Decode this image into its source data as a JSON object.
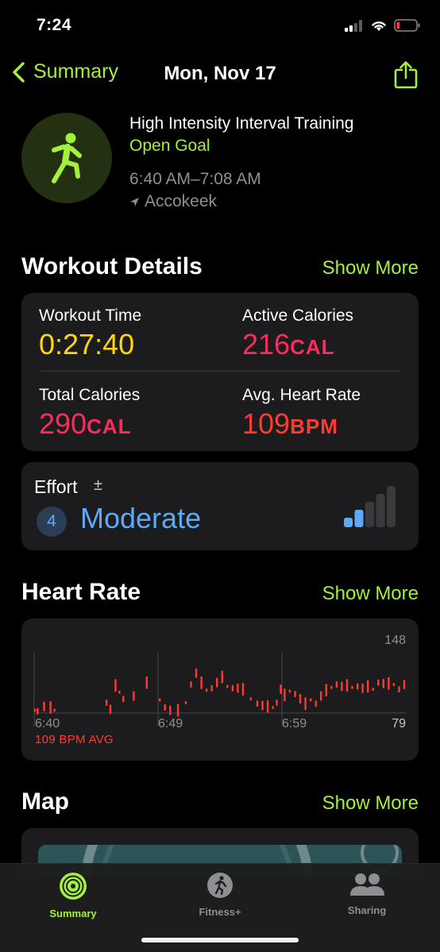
{
  "status": {
    "time": "7:24"
  },
  "nav": {
    "back_label": "Summary",
    "title": "Mon, Nov 17"
  },
  "workout": {
    "name": "High Intensity Interval Training",
    "goal": "Open Goal",
    "time_range": "6:40 AM–7:08 AM",
    "location": "Accokeek"
  },
  "details": {
    "title": "Workout Details",
    "show_more": "Show More",
    "workout_time_label": "Workout Time",
    "workout_time_value": "0:27:40",
    "active_cal_label": "Active Calories",
    "active_cal_value": "216",
    "active_cal_unit": "CAL",
    "total_cal_label": "Total Calories",
    "total_cal_value": "290",
    "total_cal_unit": "CAL",
    "avg_hr_label": "Avg. Heart Rate",
    "avg_hr_value": "109",
    "avg_hr_unit": "BPM"
  },
  "effort": {
    "label": "Effort",
    "adjust_symbol": "±",
    "score": "4",
    "level": "Moderate",
    "bars_filled": 2,
    "bars_total": 5
  },
  "heart_rate": {
    "title": "Heart Rate",
    "show_more": "Show More",
    "avg_text": "109 BPM AVG",
    "max_label": "148",
    "min_label": "79",
    "x_labels": [
      "6:40",
      "6:49",
      "6:59"
    ]
  },
  "chart_data": {
    "type": "scatter",
    "title": "Heart Rate",
    "xlabel": "",
    "ylabel": "",
    "x_ticks": [
      "6:40",
      "6:49",
      "6:59"
    ],
    "ylim": [
      79,
      148
    ],
    "annotation": "109 BPM AVG",
    "points": [
      {
        "x": 0.0,
        "y": 81
      },
      {
        "x": 0.2,
        "y": 80
      },
      {
        "x": 0.7,
        "y": 85
      },
      {
        "x": 1.2,
        "y": 84
      },
      {
        "x": 1.5,
        "y": 81
      },
      {
        "x": 5.5,
        "y": 89
      },
      {
        "x": 5.8,
        "y": 82
      },
      {
        "x": 6.2,
        "y": 107
      },
      {
        "x": 6.5,
        "y": 100
      },
      {
        "x": 6.8,
        "y": 93
      },
      {
        "x": 7.6,
        "y": 96
      },
      {
        "x": 8.6,
        "y": 110
      },
      {
        "x": 9.6,
        "y": 92
      },
      {
        "x": 10.0,
        "y": 84
      },
      {
        "x": 10.4,
        "y": 81
      },
      {
        "x": 11.0,
        "y": 81
      },
      {
        "x": 11.6,
        "y": 89
      },
      {
        "x": 12.0,
        "y": 108
      },
      {
        "x": 12.4,
        "y": 120
      },
      {
        "x": 12.8,
        "y": 110
      },
      {
        "x": 13.2,
        "y": 102
      },
      {
        "x": 13.6,
        "y": 104
      },
      {
        "x": 14.0,
        "y": 110
      },
      {
        "x": 14.4,
        "y": 116
      },
      {
        "x": 14.8,
        "y": 106
      },
      {
        "x": 15.2,
        "y": 104
      },
      {
        "x": 15.6,
        "y": 104
      },
      {
        "x": 16.0,
        "y": 103
      },
      {
        "x": 16.6,
        "y": 93
      },
      {
        "x": 17.1,
        "y": 88
      },
      {
        "x": 17.5,
        "y": 86
      },
      {
        "x": 17.9,
        "y": 85
      },
      {
        "x": 18.3,
        "y": 84
      },
      {
        "x": 18.6,
        "y": 89
      },
      {
        "x": 18.9,
        "y": 103
      },
      {
        "x": 19.2,
        "y": 97
      },
      {
        "x": 19.6,
        "y": 101
      },
      {
        "x": 20.0,
        "y": 98
      },
      {
        "x": 20.4,
        "y": 93
      },
      {
        "x": 20.8,
        "y": 88
      },
      {
        "x": 21.2,
        "y": 92
      },
      {
        "x": 21.6,
        "y": 88
      },
      {
        "x": 22.0,
        "y": 96
      },
      {
        "x": 22.4,
        "y": 102
      },
      {
        "x": 22.8,
        "y": 105
      },
      {
        "x": 23.2,
        "y": 108
      },
      {
        "x": 23.6,
        "y": 106
      },
      {
        "x": 24.0,
        "y": 107
      },
      {
        "x": 24.4,
        "y": 105
      },
      {
        "x": 24.8,
        "y": 106
      },
      {
        "x": 25.2,
        "y": 104
      },
      {
        "x": 25.6,
        "y": 106
      },
      {
        "x": 26.0,
        "y": 103
      },
      {
        "x": 26.4,
        "y": 110
      },
      {
        "x": 26.8,
        "y": 109
      },
      {
        "x": 27.2,
        "y": 109
      },
      {
        "x": 27.6,
        "y": 108
      },
      {
        "x": 28.0,
        "y": 103
      },
      {
        "x": 28.4,
        "y": 108
      }
    ],
    "colors": {
      "points": "#ff3b30"
    }
  },
  "map": {
    "title": "Map",
    "show_more": "Show More"
  },
  "tabs": [
    {
      "label": "Summary",
      "icon": "activity-rings-icon",
      "active": true
    },
    {
      "label": "Fitness+",
      "icon": "fitness-plus-icon",
      "active": false
    },
    {
      "label": "Sharing",
      "icon": "sharing-people-icon",
      "active": false
    }
  ],
  "colors": {
    "accent": "#a3f13c",
    "yellow": "#ffd60a",
    "pink": "#fa2d5a",
    "red": "#ff3b30",
    "blue": "#5ea9f5"
  }
}
